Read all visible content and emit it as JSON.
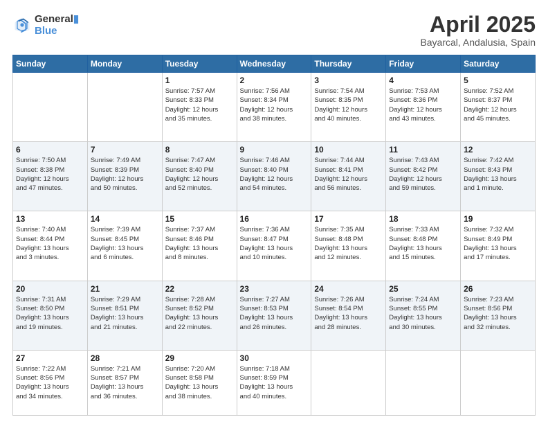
{
  "logo": {
    "line1": "General",
    "line2": "Blue"
  },
  "header": {
    "month": "April 2025",
    "location": "Bayarcal, Andalusia, Spain"
  },
  "weekdays": [
    "Sunday",
    "Monday",
    "Tuesday",
    "Wednesday",
    "Thursday",
    "Friday",
    "Saturday"
  ],
  "weeks": [
    [
      {
        "day": "",
        "info": ""
      },
      {
        "day": "",
        "info": ""
      },
      {
        "day": "1",
        "info": "Sunrise: 7:57 AM\nSunset: 8:33 PM\nDaylight: 12 hours\nand 35 minutes."
      },
      {
        "day": "2",
        "info": "Sunrise: 7:56 AM\nSunset: 8:34 PM\nDaylight: 12 hours\nand 38 minutes."
      },
      {
        "day": "3",
        "info": "Sunrise: 7:54 AM\nSunset: 8:35 PM\nDaylight: 12 hours\nand 40 minutes."
      },
      {
        "day": "4",
        "info": "Sunrise: 7:53 AM\nSunset: 8:36 PM\nDaylight: 12 hours\nand 43 minutes."
      },
      {
        "day": "5",
        "info": "Sunrise: 7:52 AM\nSunset: 8:37 PM\nDaylight: 12 hours\nand 45 minutes."
      }
    ],
    [
      {
        "day": "6",
        "info": "Sunrise: 7:50 AM\nSunset: 8:38 PM\nDaylight: 12 hours\nand 47 minutes."
      },
      {
        "day": "7",
        "info": "Sunrise: 7:49 AM\nSunset: 8:39 PM\nDaylight: 12 hours\nand 50 minutes."
      },
      {
        "day": "8",
        "info": "Sunrise: 7:47 AM\nSunset: 8:40 PM\nDaylight: 12 hours\nand 52 minutes."
      },
      {
        "day": "9",
        "info": "Sunrise: 7:46 AM\nSunset: 8:40 PM\nDaylight: 12 hours\nand 54 minutes."
      },
      {
        "day": "10",
        "info": "Sunrise: 7:44 AM\nSunset: 8:41 PM\nDaylight: 12 hours\nand 56 minutes."
      },
      {
        "day": "11",
        "info": "Sunrise: 7:43 AM\nSunset: 8:42 PM\nDaylight: 12 hours\nand 59 minutes."
      },
      {
        "day": "12",
        "info": "Sunrise: 7:42 AM\nSunset: 8:43 PM\nDaylight: 13 hours\nand 1 minute."
      }
    ],
    [
      {
        "day": "13",
        "info": "Sunrise: 7:40 AM\nSunset: 8:44 PM\nDaylight: 13 hours\nand 3 minutes."
      },
      {
        "day": "14",
        "info": "Sunrise: 7:39 AM\nSunset: 8:45 PM\nDaylight: 13 hours\nand 6 minutes."
      },
      {
        "day": "15",
        "info": "Sunrise: 7:37 AM\nSunset: 8:46 PM\nDaylight: 13 hours\nand 8 minutes."
      },
      {
        "day": "16",
        "info": "Sunrise: 7:36 AM\nSunset: 8:47 PM\nDaylight: 13 hours\nand 10 minutes."
      },
      {
        "day": "17",
        "info": "Sunrise: 7:35 AM\nSunset: 8:48 PM\nDaylight: 13 hours\nand 12 minutes."
      },
      {
        "day": "18",
        "info": "Sunrise: 7:33 AM\nSunset: 8:48 PM\nDaylight: 13 hours\nand 15 minutes."
      },
      {
        "day": "19",
        "info": "Sunrise: 7:32 AM\nSunset: 8:49 PM\nDaylight: 13 hours\nand 17 minutes."
      }
    ],
    [
      {
        "day": "20",
        "info": "Sunrise: 7:31 AM\nSunset: 8:50 PM\nDaylight: 13 hours\nand 19 minutes."
      },
      {
        "day": "21",
        "info": "Sunrise: 7:29 AM\nSunset: 8:51 PM\nDaylight: 13 hours\nand 21 minutes."
      },
      {
        "day": "22",
        "info": "Sunrise: 7:28 AM\nSunset: 8:52 PM\nDaylight: 13 hours\nand 22 minutes."
      },
      {
        "day": "23",
        "info": "Sunrise: 7:27 AM\nSunset: 8:53 PM\nDaylight: 13 hours\nand 26 minutes."
      },
      {
        "day": "24",
        "info": "Sunrise: 7:26 AM\nSunset: 8:54 PM\nDaylight: 13 hours\nand 28 minutes."
      },
      {
        "day": "25",
        "info": "Sunrise: 7:24 AM\nSunset: 8:55 PM\nDaylight: 13 hours\nand 30 minutes."
      },
      {
        "day": "26",
        "info": "Sunrise: 7:23 AM\nSunset: 8:56 PM\nDaylight: 13 hours\nand 32 minutes."
      }
    ],
    [
      {
        "day": "27",
        "info": "Sunrise: 7:22 AM\nSunset: 8:56 PM\nDaylight: 13 hours\nand 34 minutes."
      },
      {
        "day": "28",
        "info": "Sunrise: 7:21 AM\nSunset: 8:57 PM\nDaylight: 13 hours\nand 36 minutes."
      },
      {
        "day": "29",
        "info": "Sunrise: 7:20 AM\nSunset: 8:58 PM\nDaylight: 13 hours\nand 38 minutes."
      },
      {
        "day": "30",
        "info": "Sunrise: 7:18 AM\nSunset: 8:59 PM\nDaylight: 13 hours\nand 40 minutes."
      },
      {
        "day": "",
        "info": ""
      },
      {
        "day": "",
        "info": ""
      },
      {
        "day": "",
        "info": ""
      }
    ]
  ]
}
